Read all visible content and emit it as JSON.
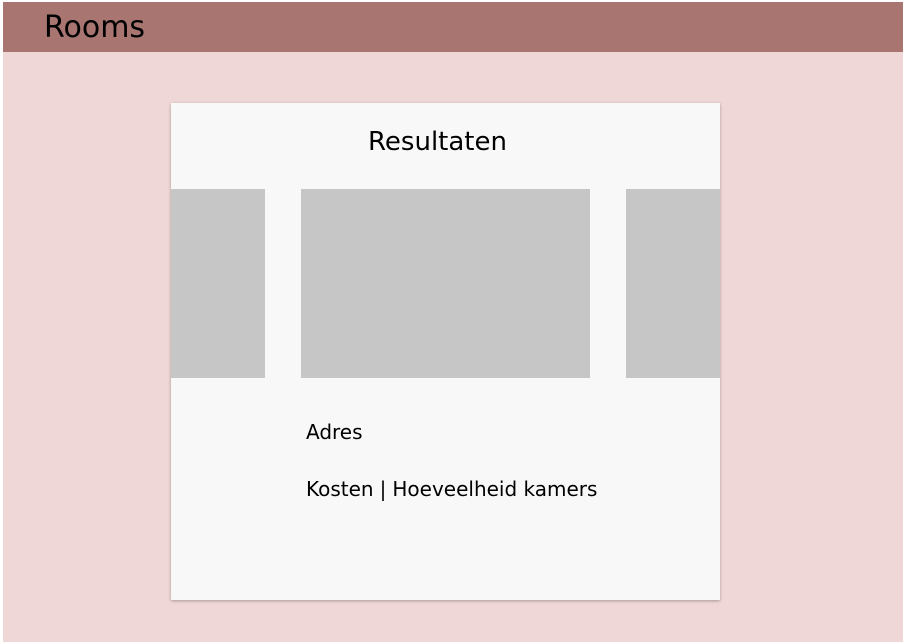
{
  "app": {
    "title": "Rooms"
  },
  "results": {
    "heading": "Resultaten",
    "listing": {
      "address_label": "Adres",
      "cost_label": "Kosten",
      "separator": "|",
      "rooms_label": "Hoeveelheid kamers"
    }
  },
  "colors": {
    "header": "#a87571",
    "background": "#efd7d7",
    "card": "#f8f8f8",
    "image_placeholder": "#c6c6c6"
  }
}
